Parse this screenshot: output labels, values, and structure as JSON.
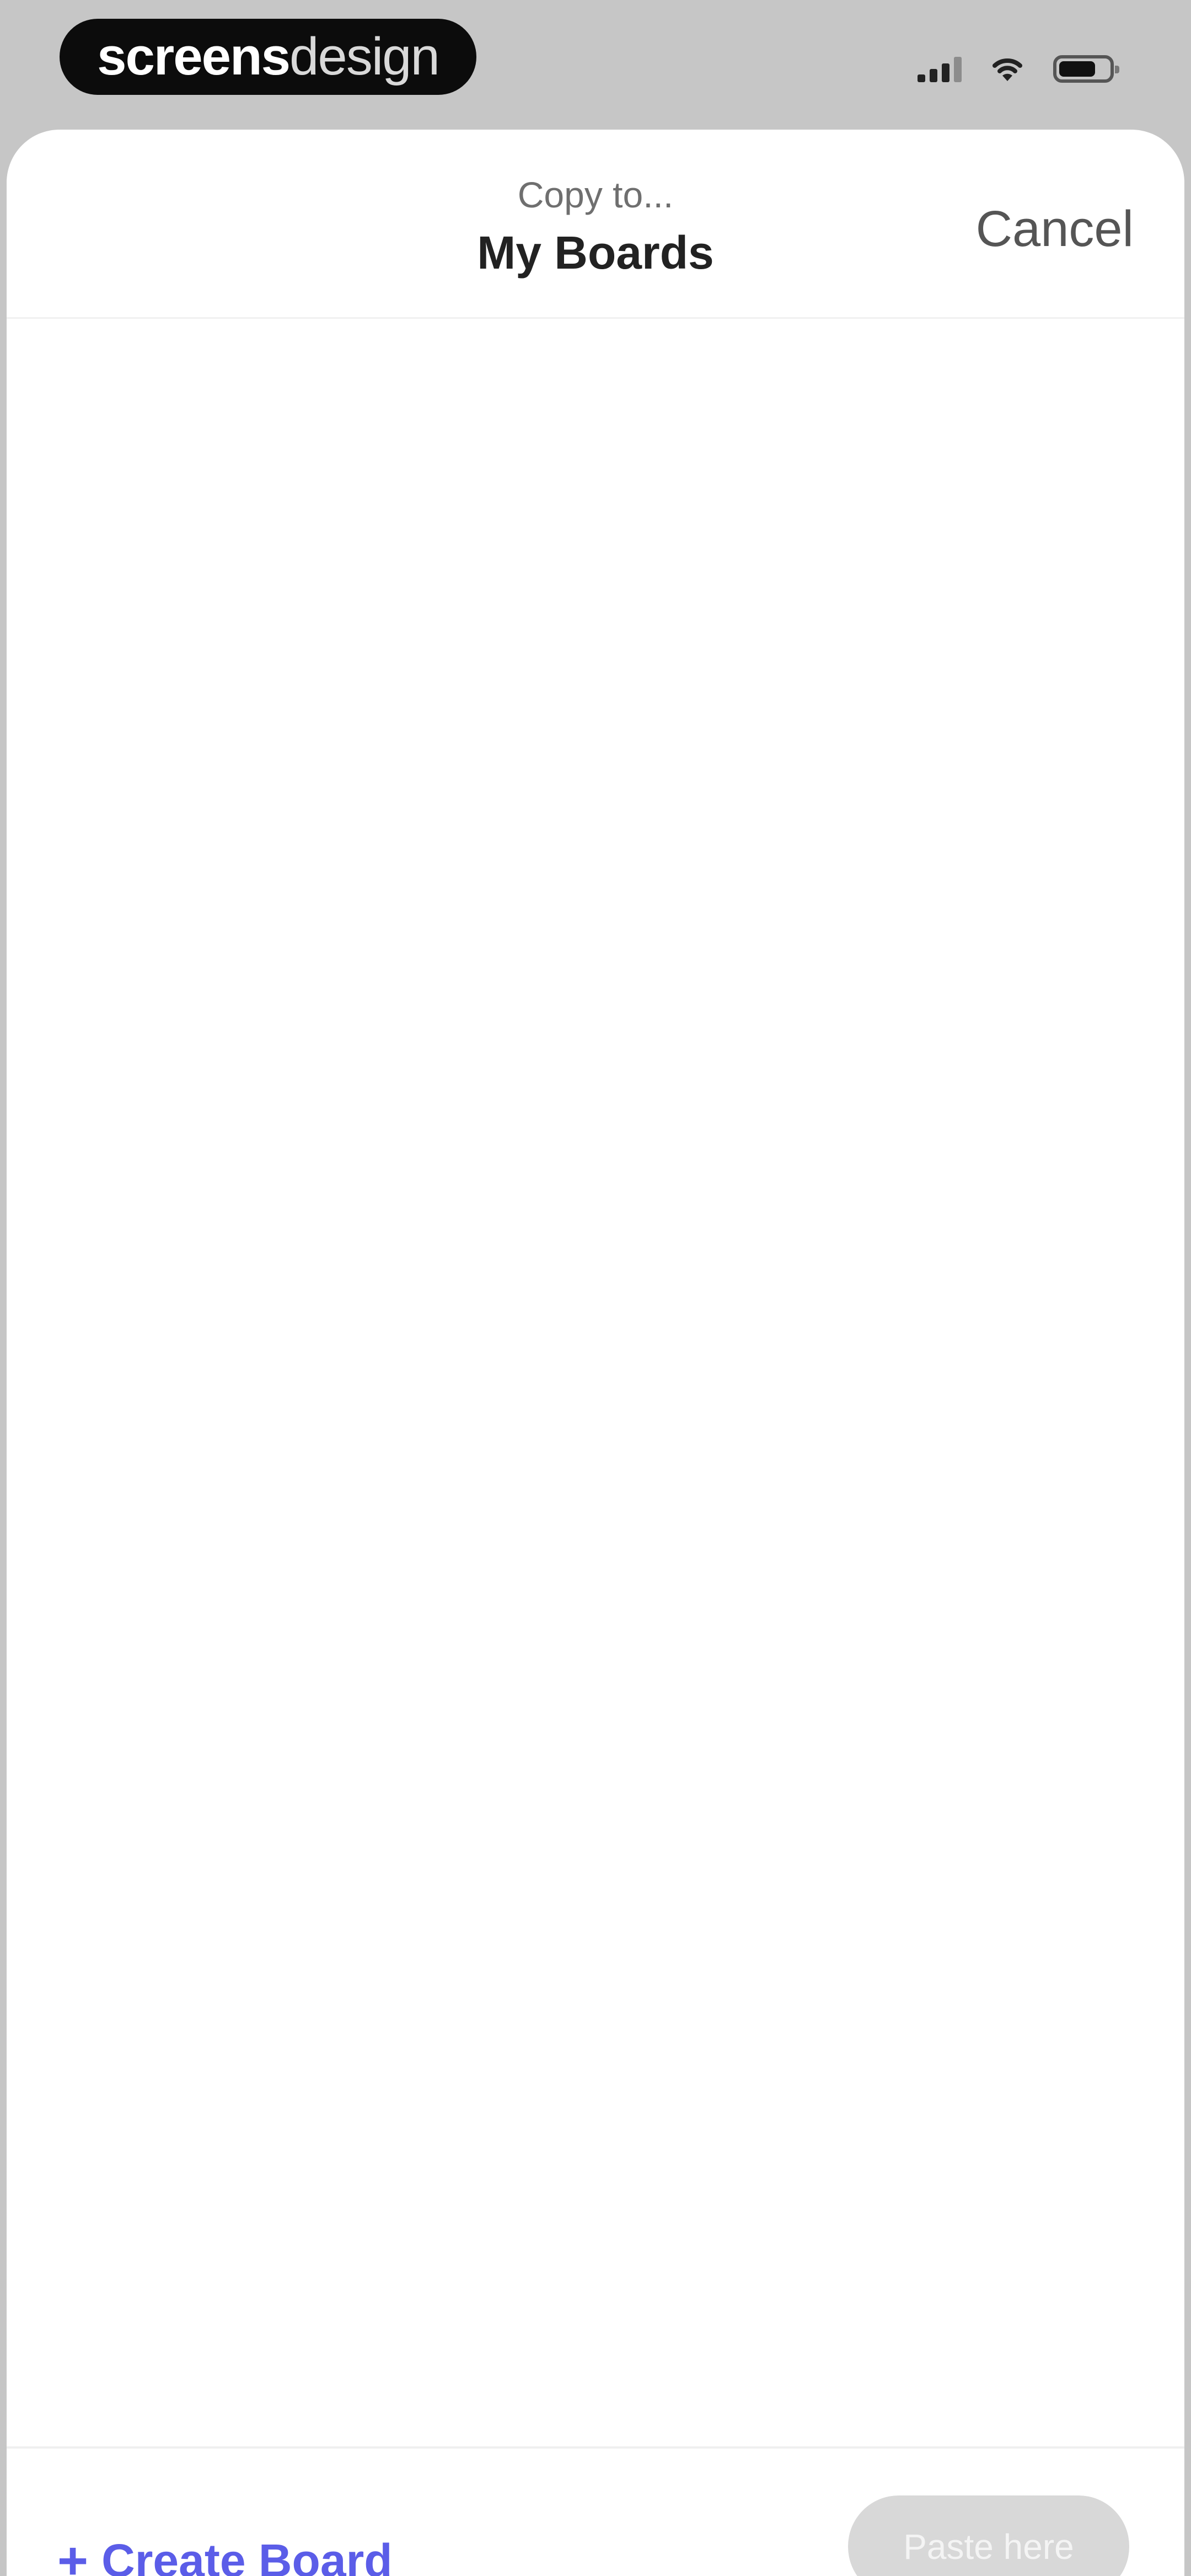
{
  "status_bar": {
    "brand_bold": "screens",
    "brand_light": "design",
    "icons": [
      "signal-icon",
      "wifi-icon",
      "battery-icon"
    ]
  },
  "sheet": {
    "subtitle": "Copy to...",
    "title": "My Boards",
    "cancel_label": "Cancel"
  },
  "footer": {
    "create_icon": "plus-icon",
    "create_label": "Create Board",
    "paste_label": "Paste here"
  },
  "colors": {
    "accent": "#5b5de8",
    "disabled_button": "#d8d8d8",
    "background": "#ffffff"
  }
}
